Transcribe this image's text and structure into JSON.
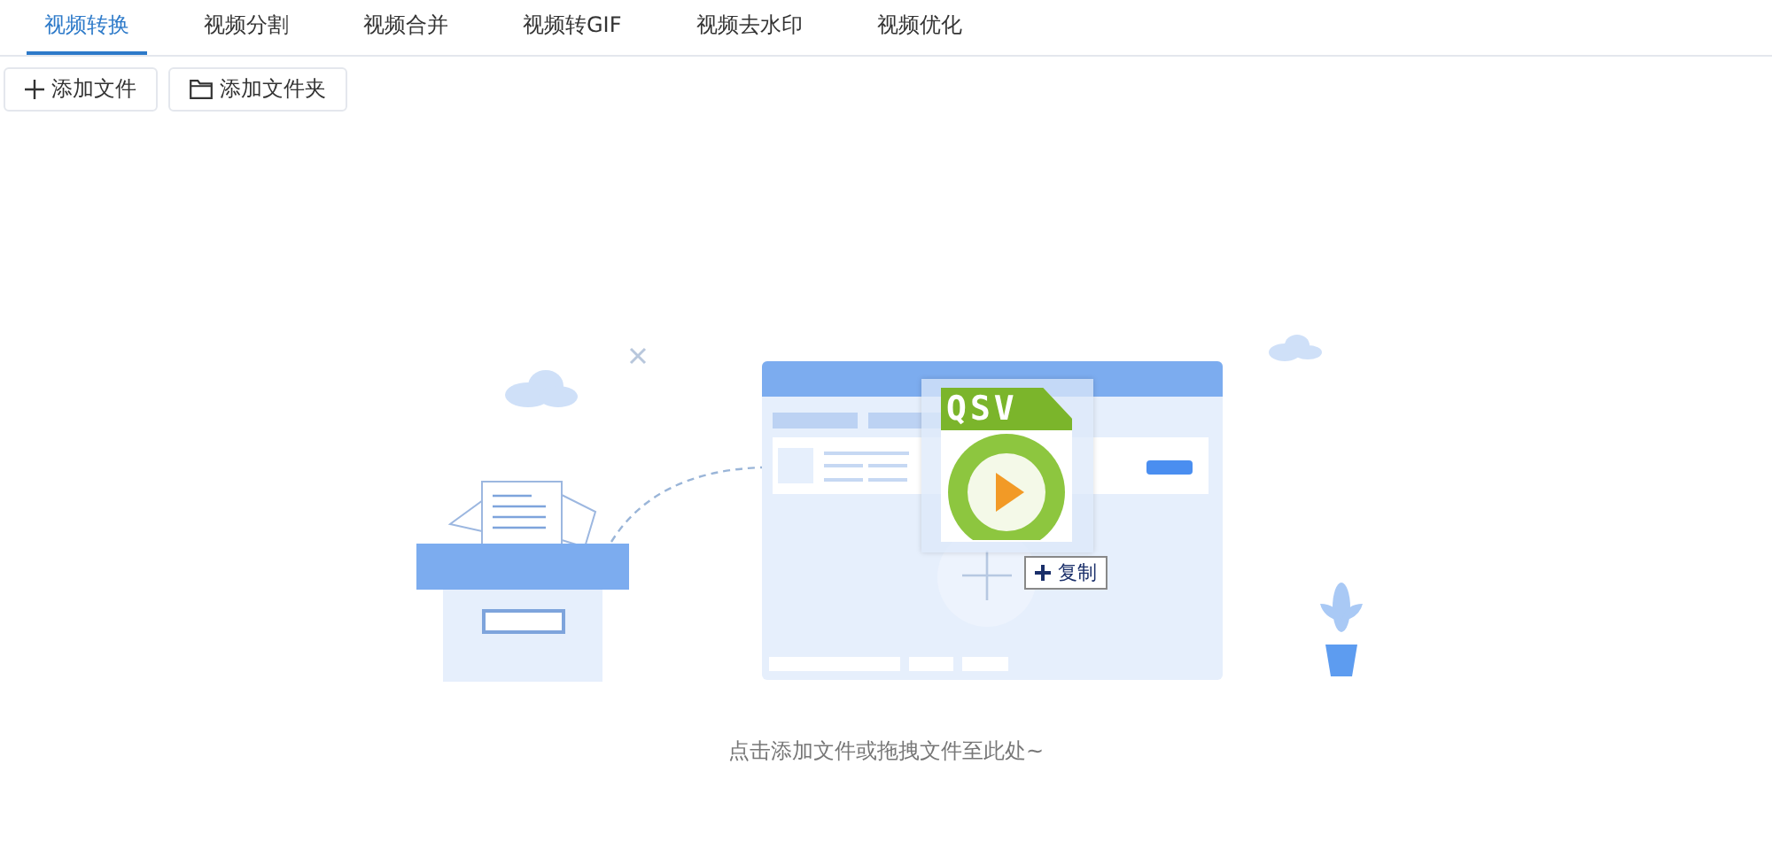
{
  "tabs": [
    {
      "label": "视频转换",
      "selected": true
    },
    {
      "label": "视频分割",
      "selected": false
    },
    {
      "label": "视频合并",
      "selected": false
    },
    {
      "label": "视频转GIF",
      "selected": false
    },
    {
      "label": "视频去水印",
      "selected": false
    },
    {
      "label": "视频优化",
      "selected": false
    }
  ],
  "toolbar": [
    {
      "kind": "add",
      "label": "添加文件"
    },
    {
      "kind": "folder",
      "label": "添加文件夹"
    }
  ],
  "drag_preview": {
    "file_type": "QSV",
    "action": "复制"
  },
  "hint": "点击添加文件或拖拽文件至此处~"
}
